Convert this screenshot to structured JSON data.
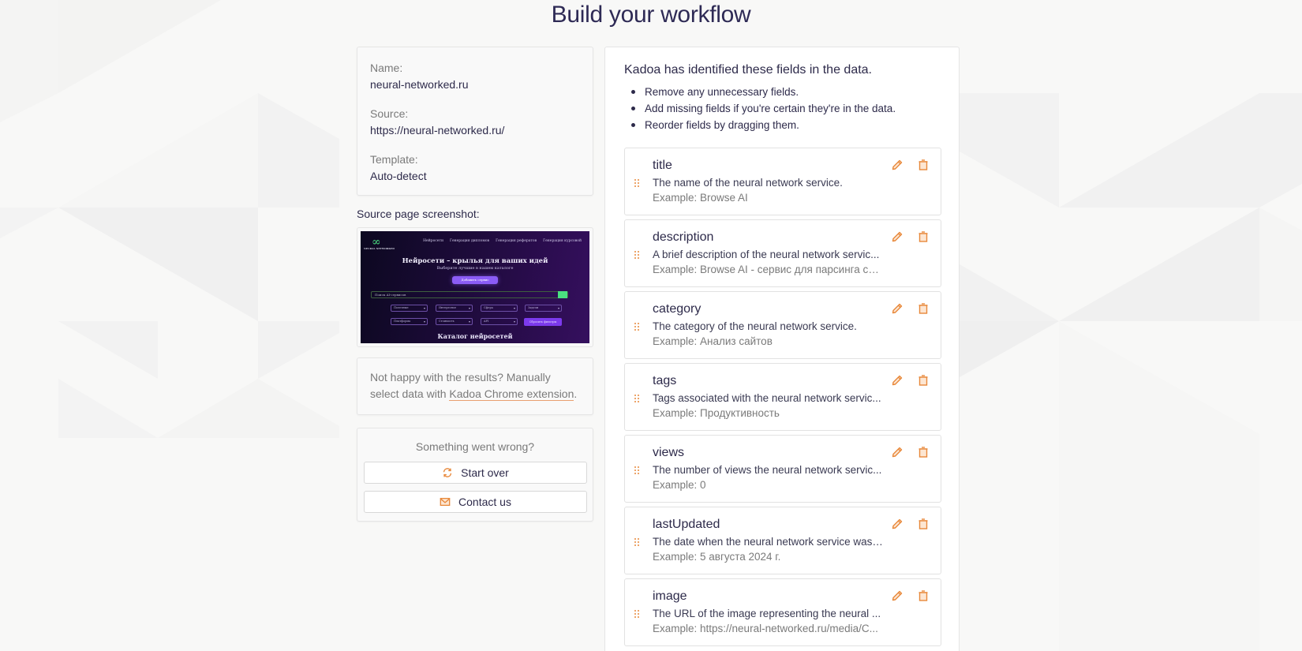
{
  "page": {
    "title": "Build your workflow"
  },
  "info": {
    "name_label": "Name:",
    "name_value": "neural-networked.ru",
    "source_label": "Source:",
    "source_value": "https://neural-networked.ru/",
    "template_label": "Template:",
    "template_value": "Auto-detect"
  },
  "screenshot": {
    "label": "Source page screenshot:",
    "thumb": {
      "logo_text": "NEURAL NETWORKED",
      "nav": [
        "Нейросети",
        "Генерация дипломов",
        "Генерация рефератов",
        "Генерация курсовой"
      ],
      "headline": "Нейросети – крылья для ваших идей",
      "subheadline": "Выберите лучшие в нашем каталоге",
      "cta": "Добавить сервис",
      "search_placeholder": "Поиск AI-сервисов",
      "filters_row1": [
        "Полезные",
        "Интересное",
        "Сфера",
        "Задачи"
      ],
      "filters_row2": [
        "Платформа",
        "Стоимость",
        "API"
      ],
      "reset": "Сбросить фильтры",
      "catalog_title": "Каталог нейросетей"
    }
  },
  "help": {
    "text_before": "Not happy with the results? Manually select data with ",
    "link_text": "Kadoa Chrome extension",
    "text_after": "."
  },
  "wrong": {
    "title": "Something went wrong?",
    "start_over": "Start over",
    "contact_us": "Contact us"
  },
  "fields_panel": {
    "intro": "Kadoa has identified these fields in the data.",
    "tips": [
      "Remove any unnecessary fields.",
      "Add missing fields if you're certain they're in the data.",
      "Reorder fields by dragging them."
    ],
    "example_prefix": "Example: ",
    "fields": [
      {
        "name": "title",
        "description": "The name of the neural network service.",
        "example": "Browse AI"
      },
      {
        "name": "description",
        "description": "A brief description of the neural network servic...",
        "example": "Browse AI - сервис для парсинга са..."
      },
      {
        "name": "category",
        "description": "The category of the neural network service.",
        "example": "Анализ сайтов"
      },
      {
        "name": "tags",
        "description": "Tags associated with the neural network servic...",
        "example": "Продуктивность"
      },
      {
        "name": "views",
        "description": "The number of views the neural network servic...",
        "example": "0"
      },
      {
        "name": "lastUpdated",
        "description": "The date when the neural network service was ...",
        "example": "5 августа 2024 г."
      },
      {
        "name": "image",
        "description": "The URL of the image representing the neural ...",
        "example": "https://neural-networked.ru/media/C..."
      }
    ]
  },
  "colors": {
    "accent": "#e8883a",
    "title": "#2e2a55",
    "text": "#2d2a4a",
    "muted": "#7a7a7a"
  }
}
